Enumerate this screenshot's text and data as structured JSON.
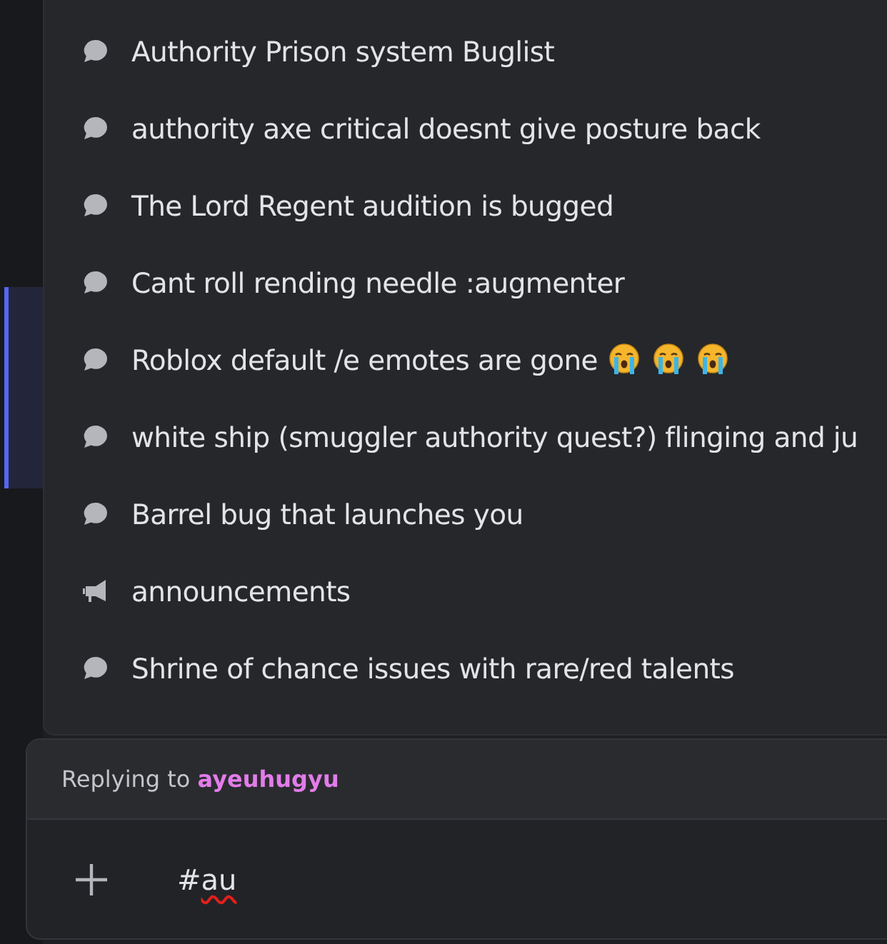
{
  "sidebar": {
    "selected_item": {
      "selected": true
    }
  },
  "suggestions": [
    {
      "kind": "thread",
      "label": "Authority Prison system Buglist"
    },
    {
      "kind": "thread",
      "label": "authority axe critical doesnt give posture back"
    },
    {
      "kind": "thread",
      "label": "The Lord Regent audition is bugged"
    },
    {
      "kind": "thread",
      "label": "Cant roll rending needle :augmenter"
    },
    {
      "kind": "thread",
      "label": "Roblox default /e emotes are gone",
      "emojis": [
        {
          "kind": "crying"
        },
        {
          "kind": "crying"
        },
        {
          "kind": "crying"
        }
      ]
    },
    {
      "kind": "thread",
      "label": "white ship (smuggler authority quest?) flinging and ju"
    },
    {
      "kind": "thread",
      "label": "Barrel bug that launches you"
    },
    {
      "kind": "announcement",
      "label": "announcements"
    },
    {
      "kind": "thread",
      "label": "Shrine of chance issues with rare/red talents"
    }
  ],
  "composer": {
    "reply_label": "Replying to",
    "reply_user": "ayeuhugyu",
    "value": "#au",
    "spell_error": true
  }
}
